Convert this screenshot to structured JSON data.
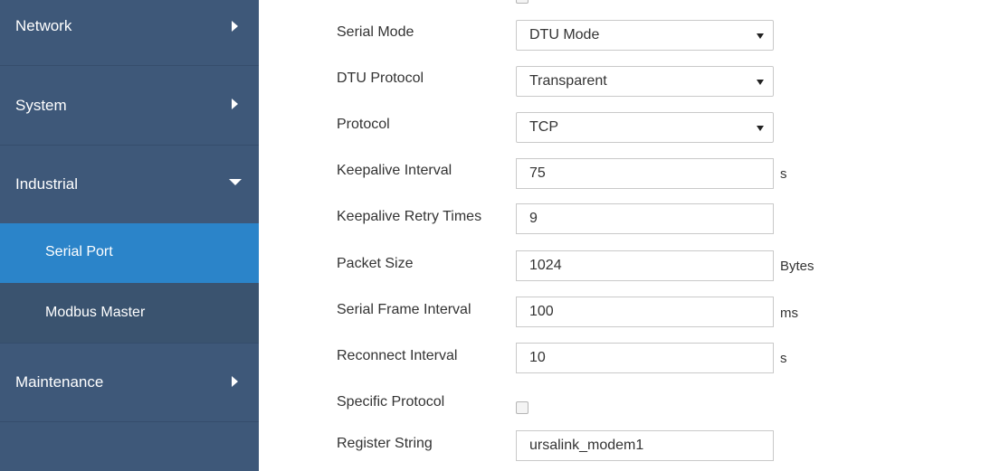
{
  "sidebar": {
    "items": [
      {
        "label": "Network"
      },
      {
        "label": "System"
      },
      {
        "label": "Industrial"
      },
      {
        "label": "Serial Port"
      },
      {
        "label": "Modbus Master"
      },
      {
        "label": "Maintenance"
      }
    ]
  },
  "form": {
    "serial_mode": {
      "label": "Serial Mode",
      "value": "DTU Mode"
    },
    "dtu_protocol": {
      "label": "DTU Protocol",
      "value": "Transparent"
    },
    "protocol": {
      "label": "Protocol",
      "value": "TCP"
    },
    "keepalive_interval": {
      "label": "Keepalive Interval",
      "value": "75",
      "unit": "s"
    },
    "keepalive_retry": {
      "label": "Keepalive Retry Times",
      "value": "9"
    },
    "packet_size": {
      "label": "Packet Size",
      "value": "1024",
      "unit": "Bytes"
    },
    "serial_frame_interval": {
      "label": "Serial Frame Interval",
      "value": "100",
      "unit": "ms"
    },
    "reconnect_interval": {
      "label": "Reconnect Interval",
      "value": "10",
      "unit": "s"
    },
    "specific_protocol": {
      "label": "Specific Protocol",
      "checked": false
    },
    "register_string": {
      "label": "Register String",
      "value": "ursalink_modem1"
    }
  }
}
